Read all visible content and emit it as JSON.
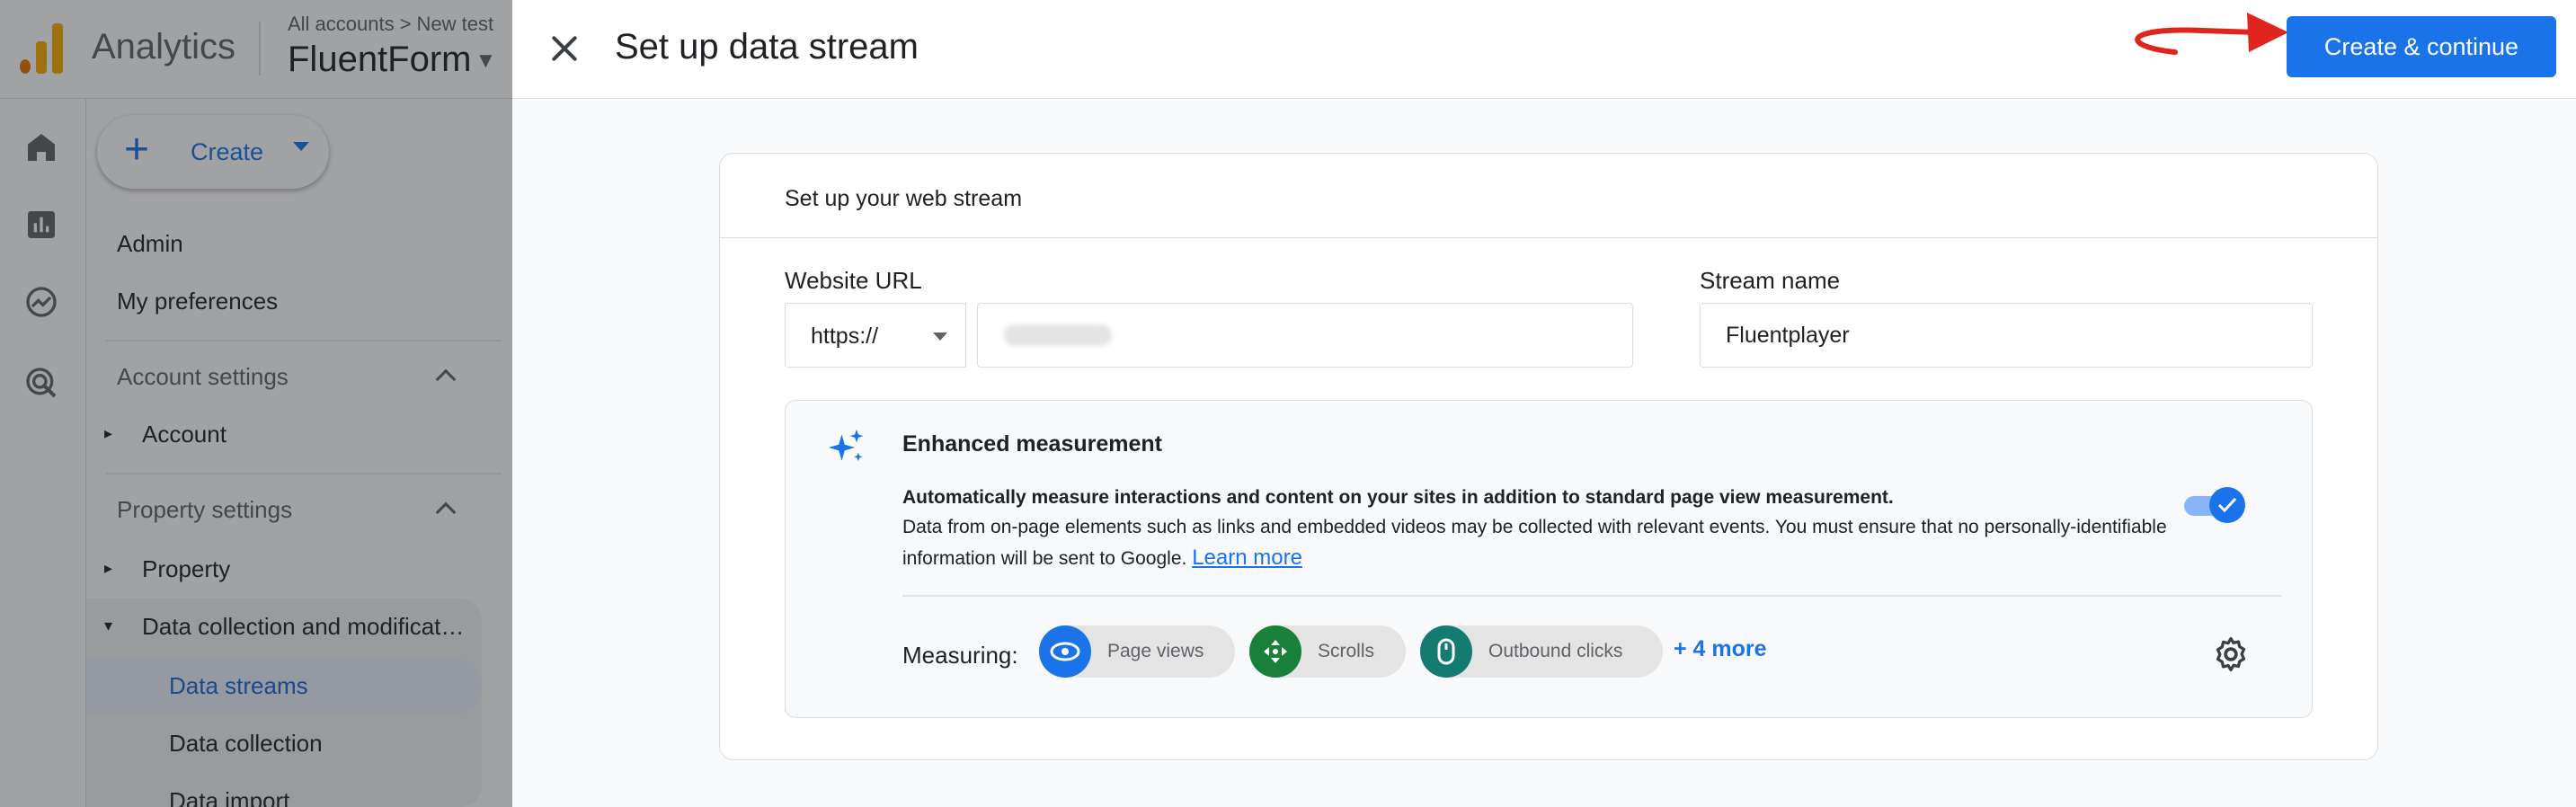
{
  "app": {
    "product_name": "Analytics",
    "breadcrumb": [
      "All accounts",
      "New test"
    ],
    "breadcrumb_sep": ">",
    "account_name": "FluentForm"
  },
  "sidebar": {
    "create_label": "Create",
    "items": {
      "admin": "Admin",
      "preferences": "My preferences",
      "account_settings": "Account settings",
      "account": "Account",
      "property_settings": "Property settings",
      "property": "Property",
      "data_collection_mod": "Data collection and modificat…",
      "data_streams": "Data streams",
      "data_collection": "Data collection",
      "data_import": "Data import"
    }
  },
  "dialog": {
    "title": "Set up data stream",
    "primary_button": "Create & continue",
    "card_title": "Set up your web stream",
    "website_url_label": "Website URL",
    "protocol_value": "https://",
    "url_value": "",
    "stream_name_label": "Stream name",
    "stream_name_value": "Fluentplayer",
    "enhanced": {
      "title": "Enhanced measurement",
      "desc_bold": "Automatically measure interactions and content on your sites in addition to standard page view measurement.",
      "desc": "Data from on-page elements such as links and embedded videos may be collected with relevant events. You must ensure that no personally-identifiable information will be sent to Google.",
      "learn_more": "Learn more",
      "toggle_on": true,
      "measuring_label": "Measuring:",
      "chips": [
        "Page views",
        "Scrolls",
        "Outbound clicks"
      ],
      "more_link": "+ 4 more"
    }
  },
  "colors": {
    "primary": "#1a73e8",
    "chip_page_views": "#1a73e8",
    "chip_scrolls": "#188038",
    "chip_outbound": "#137b72",
    "annotation_arrow": "#e0241e"
  }
}
